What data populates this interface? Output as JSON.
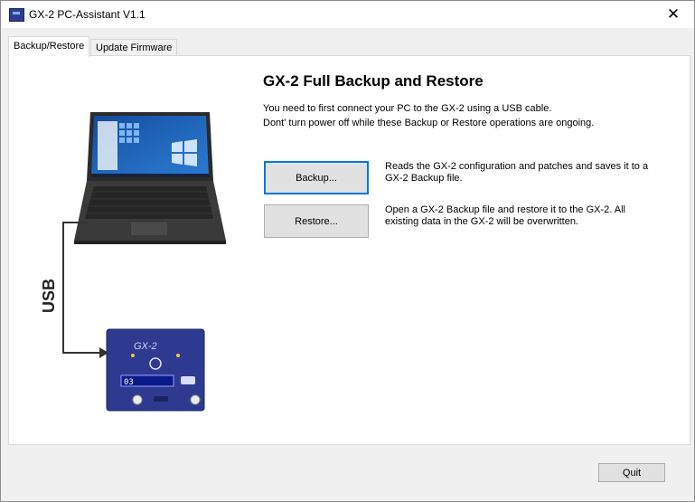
{
  "window": {
    "title": "GX-2 PC-Assistant V1.1",
    "close_glyph": "✕"
  },
  "tabs": [
    {
      "label": "Backup/Restore",
      "active": true
    },
    {
      "label": "Update Firmware",
      "active": false
    }
  ],
  "main": {
    "heading": "GX-2 Full Backup and Restore",
    "intro_line1": "You need to first connect your PC to the GX-2 using a USB cable.",
    "intro_line2": "Dont' turn power off while these Backup or Restore operations are ongoing.",
    "backup": {
      "label": "Backup...",
      "description": "Reads the GX-2 configuration and patches and saves it to a GX-2 Backup file."
    },
    "restore": {
      "label": "Restore...",
      "description": "Open a GX-2 Backup file and restore it to the GX-2. All existing data in the GX-2 will be overwritten."
    }
  },
  "illustration": {
    "usb_label": "USB",
    "device_lcd": "03",
    "device_logo": "GX-2"
  },
  "footer": {
    "quit_label": "Quit"
  },
  "colors": {
    "accent": "#0078d7",
    "device": "#2e3a8f",
    "laptop": "#3a3a3a"
  }
}
